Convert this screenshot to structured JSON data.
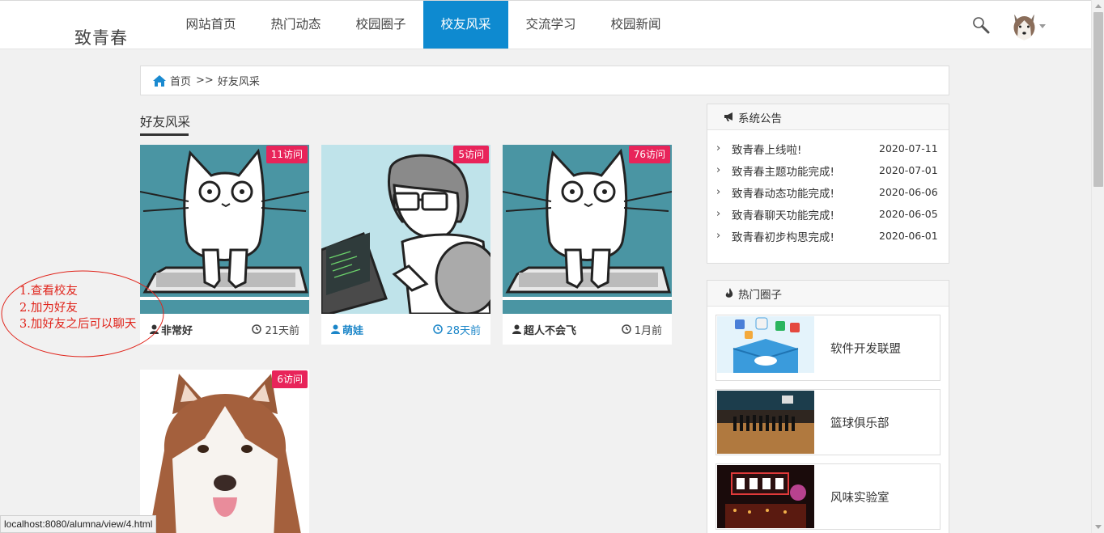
{
  "site": {
    "logo": "致青春"
  },
  "nav": {
    "items": [
      {
        "label": "网站首页"
      },
      {
        "label": "热门动态"
      },
      {
        "label": "校园圈子"
      },
      {
        "label": "校友风采",
        "active": true
      },
      {
        "label": "交流学习"
      },
      {
        "label": "校园新闻"
      }
    ],
    "accent_color": "#0e8ad0"
  },
  "breadcrumb": {
    "home": "首页",
    "separator": ">>",
    "current": "好友风采"
  },
  "section": {
    "title": "好友风采"
  },
  "cards": [
    {
      "name": "非常好",
      "time": "21天前",
      "visits": "11访问",
      "avatar": "cat-keyboard",
      "highlight": false
    },
    {
      "name": "萌娃",
      "time": "28天前",
      "visits": "5访问",
      "avatar": "programmer",
      "highlight": true
    },
    {
      "name": "超人不会飞",
      "time": "1月前",
      "visits": "76访问",
      "avatar": "cat-keyboard",
      "highlight": false
    },
    {
      "name": "",
      "time": "",
      "visits": "6访问",
      "avatar": "husky",
      "highlight": false
    }
  ],
  "annotation": {
    "lines": [
      "1.查看校友",
      "2.加为好友",
      "3.加好友之后可以聊天"
    ],
    "color": "#e0241b"
  },
  "notice": {
    "title": "系统公告",
    "items": [
      {
        "title": "致青春上线啦!",
        "date": "2020-07-11"
      },
      {
        "title": "致青春主题功能完成!",
        "date": "2020-07-01"
      },
      {
        "title": "致青春动态功能完成!",
        "date": "2020-06-06"
      },
      {
        "title": "致青春聊天功能完成!",
        "date": "2020-06-05"
      },
      {
        "title": "致青春初步构思完成!",
        "date": "2020-06-01"
      }
    ]
  },
  "hot_circles": {
    "title": "热门圈子",
    "items": [
      {
        "name": "软件开发联盟",
        "image": "cloud-box"
      },
      {
        "name": "篮球俱乐部",
        "image": "basketball-court"
      },
      {
        "name": "风味实验室",
        "image": "food-street"
      }
    ]
  },
  "statusbar": {
    "url": "localhost:8080/alumna/view/4.html"
  },
  "colors": {
    "badge": "#e8245a",
    "link_blue": "#1a85c8",
    "teal_card": "#4a95a3"
  }
}
